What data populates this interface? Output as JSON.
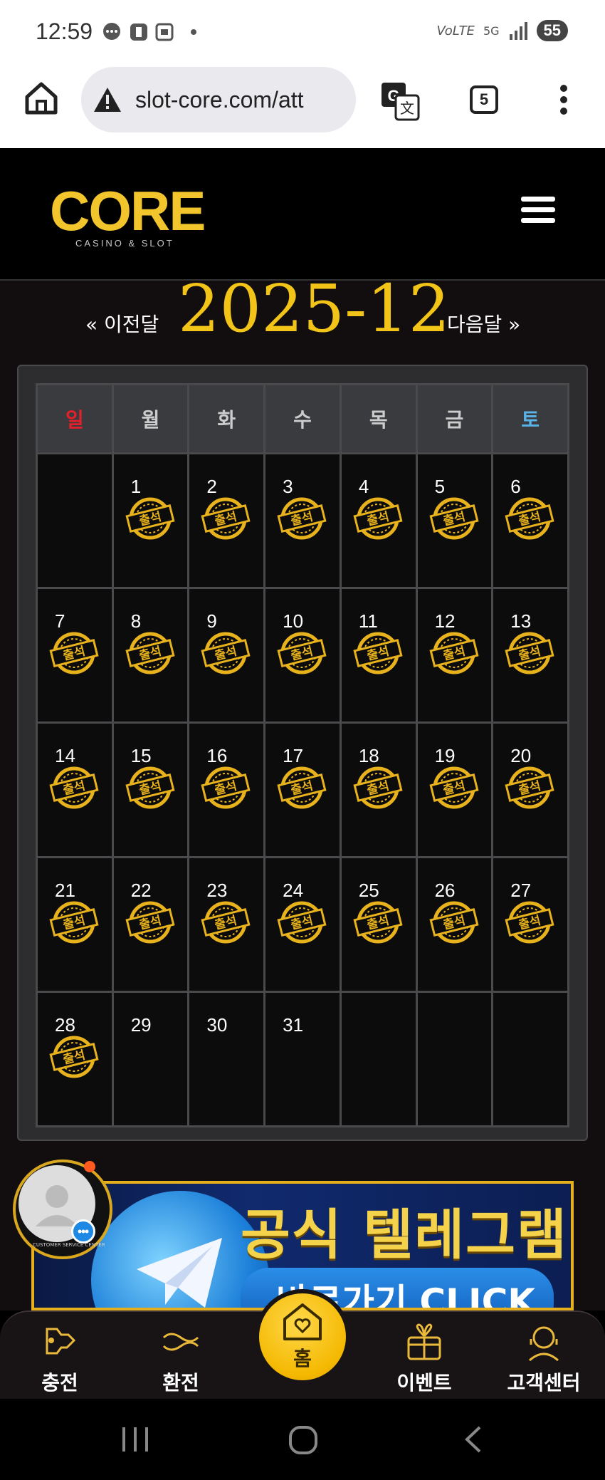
{
  "status_bar": {
    "time": "12:59",
    "battery": "55",
    "network": "5G"
  },
  "browser": {
    "url": "slot-core.com/att",
    "tab_count": "5"
  },
  "header": {
    "logo_text": "CORE",
    "logo_tagline": "CASINO & SLOT"
  },
  "calendar": {
    "prev_label": "« 이전달",
    "next_label": "다음달 »",
    "month_title": "2025-12",
    "weekdays": [
      "일",
      "월",
      "화",
      "수",
      "목",
      "금",
      "토"
    ],
    "leading_blanks": 1,
    "days_in_month": 31,
    "stamped_days": [
      1,
      2,
      3,
      4,
      5,
      6,
      7,
      8,
      9,
      10,
      11,
      12,
      13,
      14,
      15,
      16,
      17,
      18,
      19,
      20,
      21,
      22,
      23,
      24,
      25,
      26,
      27,
      28
    ],
    "stamp_text": "출석"
  },
  "banner": {
    "title": "공식 텔레그램",
    "cta": "바로가기 CLICK"
  },
  "cs_widget": {
    "label": "CUSTOMER SERVICE CENTER"
  },
  "bottom_nav": {
    "charge": "충전",
    "exchange": "환전",
    "home": "홈",
    "event": "이벤트",
    "support": "고객센터"
  }
}
